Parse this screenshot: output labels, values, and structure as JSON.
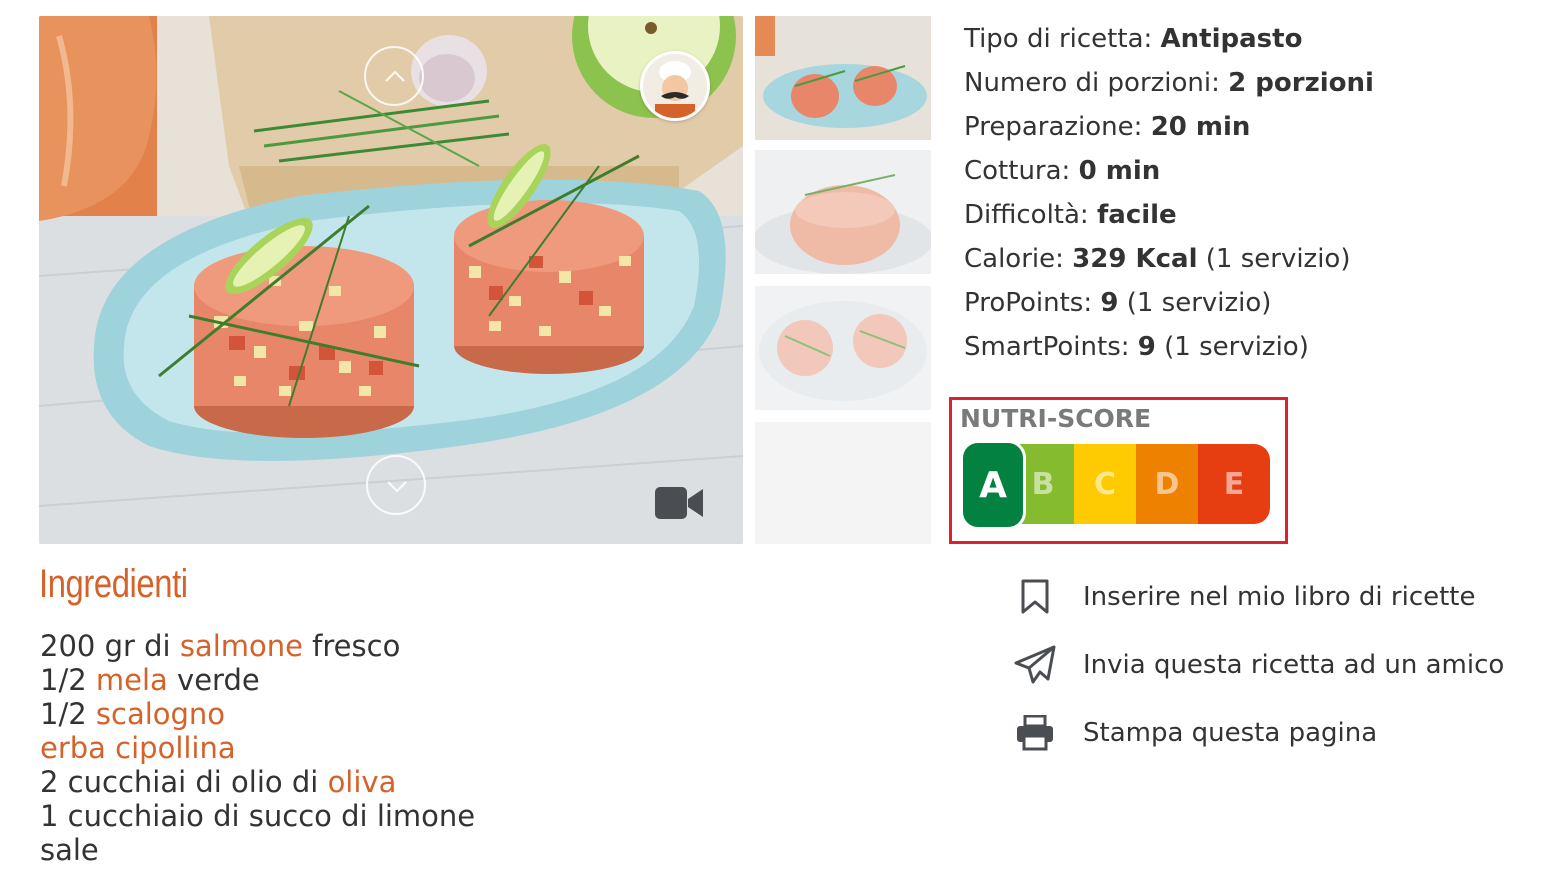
{
  "recipe_info": {
    "type_label": "Tipo di ricetta:",
    "type_value": "Antipasto",
    "portions_label": "Numero di porzioni:",
    "portions_value": "2 porzioni",
    "prep_label": "Preparazione:",
    "prep_value": "20 min",
    "cook_label": "Cottura:",
    "cook_value": "0 min",
    "difficulty_label": "Difficoltà:",
    "difficulty_value": "facile",
    "calories_label": "Calorie:",
    "calories_value": "329 Kcal",
    "calories_note": "(1 servizio)",
    "propoints_label": "ProPoints:",
    "propoints_value": "9",
    "propoints_note": "(1 servizio)",
    "smartpoints_label": "SmartPoints:",
    "smartpoints_value": "9",
    "smartpoints_note": "(1 servizio)"
  },
  "nutri_score": {
    "title": "NUTRI-SCORE",
    "selected": "A",
    "grades": [
      "B",
      "C",
      "D",
      "E"
    ],
    "colors": {
      "A": "#038141",
      "B": "#85bb2f",
      "C": "#fecb02",
      "D": "#ee8100",
      "E": "#e63e11"
    },
    "highlight_color": "#e0202e"
  },
  "actions": [
    {
      "label": "Inserire nel mio libro di ricette",
      "icon": "bookmark-icon"
    },
    {
      "label": "Invia questa ricetta ad un amico",
      "icon": "paper-plane-icon"
    },
    {
      "label": "Stampa questa pagina",
      "icon": "printer-icon"
    }
  ],
  "gallery": {
    "main_image": "salmon-tartare-photo",
    "thumbnails": [
      "thumbnail-1",
      "thumbnail-2",
      "thumbnail-3"
    ],
    "icons": [
      "chevron-up-icon",
      "chevron-down-icon",
      "video-camera-icon",
      "chef-avatar-icon"
    ]
  },
  "ingredients": {
    "title": "Ingredienti",
    "items": [
      {
        "prefix": "200 gr di ",
        "link": "salmone",
        "suffix": " fresco"
      },
      {
        "prefix": "1/2 ",
        "link": "mela",
        "suffix": " verde"
      },
      {
        "prefix": "1/2 ",
        "link": "scalogno",
        "suffix": ""
      },
      {
        "prefix": "",
        "link": "erba cipollina",
        "suffix": ""
      },
      {
        "prefix": "2 cucchiai di olio di ",
        "link": "oliva",
        "suffix": ""
      },
      {
        "prefix": "1 cucchiaio di succo di limone",
        "link": "",
        "suffix": ""
      },
      {
        "prefix": "sale",
        "link": "",
        "suffix": ""
      }
    ]
  },
  "colors": {
    "accent": "#d4622a",
    "text": "#333333"
  }
}
